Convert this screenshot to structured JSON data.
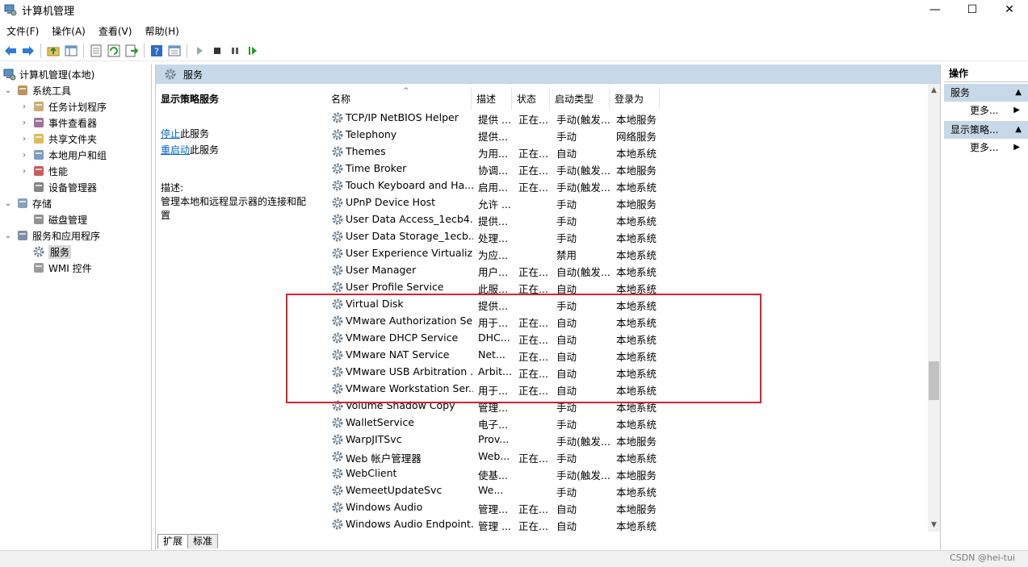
{
  "window": {
    "title": "计算机管理",
    "minimize_glyph": "—",
    "maximize_glyph": "☐",
    "close_glyph": "✕"
  },
  "menu": [
    "文件(F)",
    "操作(A)",
    "查看(V)",
    "帮助(H)"
  ],
  "toolbar_icons": [
    "back-icon",
    "forward-icon",
    "up-folder-icon",
    "show-hide-tree-icon",
    "properties-icon",
    "refresh-icon",
    "export-icon",
    "help-icon",
    "view-icon",
    "play-icon",
    "stop-icon",
    "pause-icon",
    "resume-icon"
  ],
  "tree": {
    "root": "计算机管理(本地)",
    "items": [
      {
        "label": "系统工具",
        "level": 1,
        "expand": "⌄",
        "icon": "tools-icon"
      },
      {
        "label": "任务计划程序",
        "level": 2,
        "expand": "›",
        "icon": "clock-icon"
      },
      {
        "label": "事件查看器",
        "level": 2,
        "expand": "›",
        "icon": "event-viewer-icon"
      },
      {
        "label": "共享文件夹",
        "level": 2,
        "expand": "›",
        "icon": "shared-folder-icon"
      },
      {
        "label": "本地用户和组",
        "level": 2,
        "expand": "›",
        "icon": "users-icon"
      },
      {
        "label": "性能",
        "level": 2,
        "expand": "›",
        "icon": "performance-icon"
      },
      {
        "label": "设备管理器",
        "level": 2,
        "expand": "",
        "icon": "device-manager-icon"
      },
      {
        "label": "存储",
        "level": 1,
        "expand": "⌄",
        "icon": "storage-icon"
      },
      {
        "label": "磁盘管理",
        "level": 2,
        "expand": "",
        "icon": "disk-icon"
      },
      {
        "label": "服务和应用程序",
        "level": 1,
        "expand": "⌄",
        "icon": "services-apps-icon"
      },
      {
        "label": "服务",
        "level": 2,
        "expand": "",
        "icon": "gear-icon",
        "selected": true
      },
      {
        "label": "WMI 控件",
        "level": 2,
        "expand": "",
        "icon": "wmi-icon"
      }
    ]
  },
  "main": {
    "header": "服务",
    "description": {
      "service_name": "显示策略服务",
      "stop_link": "停止",
      "stop_rest": "此服务",
      "restart_link": "重启动",
      "restart_rest": "此服务",
      "desc_label": "描述:",
      "desc_text": "管理本地和远程显示器的连接和配置"
    },
    "columns": [
      "名称",
      "描述",
      "状态",
      "启动类型",
      "登录为"
    ],
    "sort_glyph": "^",
    "rows": [
      [
        "TCP/IP NetBIOS Helper",
        "提供 ...",
        "正在...",
        "手动(触发...",
        "本地服务"
      ],
      [
        "Telephony",
        "提供...",
        "",
        "手动",
        "网络服务"
      ],
      [
        "Themes",
        "为用...",
        "正在...",
        "自动",
        "本地系统"
      ],
      [
        "Time Broker",
        "协调...",
        "正在...",
        "手动(触发...",
        "本地服务"
      ],
      [
        "Touch Keyboard and Ha...",
        "启用...",
        "正在...",
        "手动(触发...",
        "本地系统"
      ],
      [
        "UPnP Device Host",
        "允许 ...",
        "",
        "手动",
        "本地服务"
      ],
      [
        "User Data Access_1ecb4...",
        "提供...",
        "",
        "手动",
        "本地系统"
      ],
      [
        "User Data Storage_1ecb...",
        "处理...",
        "",
        "手动",
        "本地系统"
      ],
      [
        "User Experience Virtualiz...",
        "为应...",
        "",
        "禁用",
        "本地系统"
      ],
      [
        "User Manager",
        "用户...",
        "正在...",
        "自动(触发...",
        "本地系统"
      ],
      [
        "User Profile Service",
        "此服...",
        "正在...",
        "自动",
        "本地系统"
      ],
      [
        "Virtual Disk",
        "提供...",
        "",
        "手动",
        "本地系统"
      ],
      [
        "VMware Authorization Se...",
        "用于...",
        "正在...",
        "自动",
        "本地系统"
      ],
      [
        "VMware DHCP Service",
        "DHC...",
        "正在...",
        "自动",
        "本地系统"
      ],
      [
        "VMware NAT Service",
        "Net...",
        "正在...",
        "自动",
        "本地系统"
      ],
      [
        "VMware USB Arbitration ...",
        "Arbit...",
        "正在...",
        "自动",
        "本地系统"
      ],
      [
        "VMware Workstation Ser...",
        "用于...",
        "正在...",
        "自动",
        "本地系统"
      ],
      [
        "Volume Shadow Copy",
        "管理...",
        "",
        "手动",
        "本地系统"
      ],
      [
        "WalletService",
        "电子...",
        "",
        "手动",
        "本地系统"
      ],
      [
        "WarpJITSvc",
        "Prov...",
        "",
        "手动(触发...",
        "本地服务"
      ],
      [
        "Web 帐户管理器",
        "Web...",
        "正在...",
        "手动",
        "本地系统"
      ],
      [
        "WebClient",
        "使基...",
        "",
        "手动(触发...",
        "本地服务"
      ],
      [
        "WemeetUpdateSvc",
        "We...",
        "",
        "手动",
        "本地系统"
      ],
      [
        "Windows Audio",
        "管理...",
        "正在...",
        "自动",
        "本地服务"
      ],
      [
        "Windows Audio Endpoint...",
        "管理 ...",
        "正在...",
        "自动",
        "本地系统"
      ]
    ],
    "tabs": [
      "扩展",
      "标准"
    ]
  },
  "actions": {
    "header": "操作",
    "sections": [
      {
        "title": "服务",
        "more": "更多..."
      },
      {
        "title": "显示策略...",
        "more": "更多..."
      }
    ]
  },
  "watermark": "CSDN @hei-tui",
  "colors": {
    "header_bg": "#c7d8e8",
    "highlight": "#d9232e",
    "link": "#0066cc"
  }
}
